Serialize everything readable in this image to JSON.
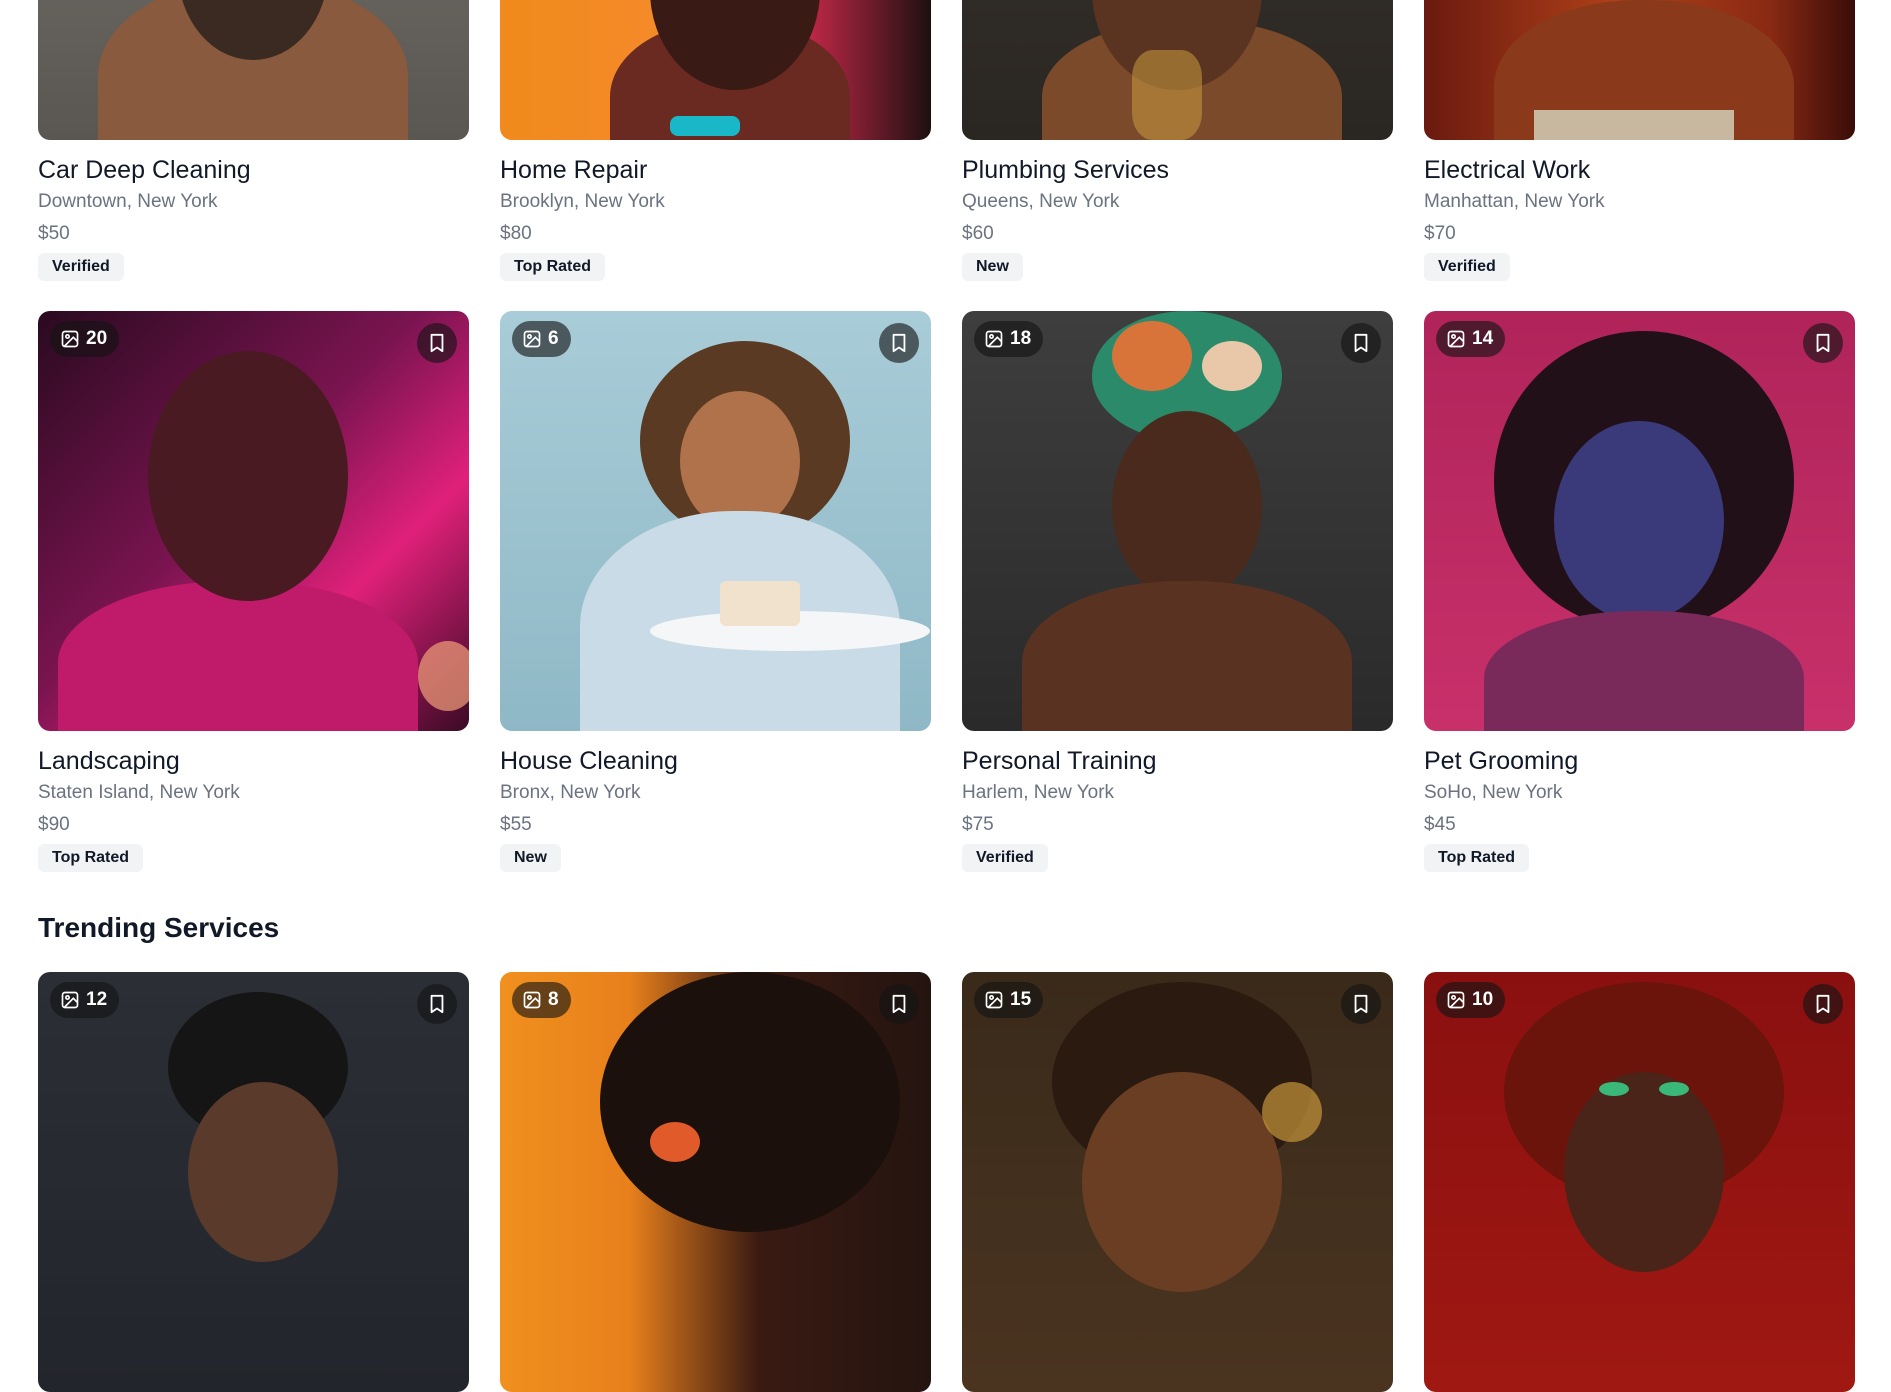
{
  "top_row": [
    {
      "title": "Car Deep Cleaning",
      "location": "Downtown, New York",
      "price": "$50",
      "badge": "Verified"
    },
    {
      "title": "Home Repair",
      "location": "Brooklyn, New York",
      "price": "$80",
      "badge": "Top Rated"
    },
    {
      "title": "Plumbing Services",
      "location": "Queens, New York",
      "price": "$60",
      "badge": "New"
    },
    {
      "title": "Electrical Work",
      "location": "Manhattan, New York",
      "price": "$70",
      "badge": "Verified"
    }
  ],
  "middle_row": [
    {
      "photo_count": "20",
      "title": "Landscaping",
      "location": "Staten Island, New York",
      "price": "$90",
      "badge": "Top Rated"
    },
    {
      "photo_count": "6",
      "title": "House Cleaning",
      "location": "Bronx, New York",
      "price": "$55",
      "badge": "New"
    },
    {
      "photo_count": "18",
      "title": "Personal Training",
      "location": "Harlem, New York",
      "price": "$75",
      "badge": "Verified"
    },
    {
      "photo_count": "14",
      "title": "Pet Grooming",
      "location": "SoHo, New York",
      "price": "$45",
      "badge": "Top Rated"
    }
  ],
  "trending": {
    "heading": "Trending Services",
    "cards": [
      {
        "photo_count": "12"
      },
      {
        "photo_count": "8"
      },
      {
        "photo_count": "15"
      },
      {
        "photo_count": "10"
      }
    ]
  },
  "icons": {
    "photo_count": "image-icon",
    "save": "bookmark-icon"
  },
  "colors": {
    "text": "#111827",
    "muted": "#6b7280",
    "badge_bg": "#f1f3f5",
    "pill_bg": "#141414"
  }
}
